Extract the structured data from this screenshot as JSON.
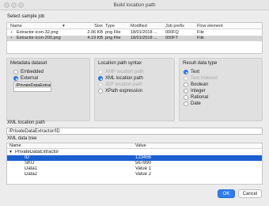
{
  "window": {
    "title": "Build location path"
  },
  "sample_job": {
    "label": "Select sample job",
    "columns": [
      "Name",
      "Size",
      "Type",
      "Modified",
      "Job prefix",
      "Flow element"
    ],
    "rows": [
      {
        "name": "Extractor-icon-32.png",
        "size": "2.06 KB",
        "type": "png File",
        "modified": "18/01/2018 ...",
        "prefix": "000FQ",
        "flow": "File"
      },
      {
        "name": "Extractor-icon-200.png",
        "size": "4.19 KB",
        "type": "png File",
        "modified": "18/01/2018 ...",
        "prefix": "000FT",
        "flow": "File"
      }
    ]
  },
  "metadata_dataset": {
    "label": "Metadata dataset",
    "options": [
      "Embedded",
      "External"
    ],
    "selected": "External",
    "list_item": "/PrivateDataExtractor"
  },
  "location_syntax": {
    "label": "Location path syntax",
    "options": [
      "XMP location path",
      "XML location path",
      "JDF location path",
      "XPath expression"
    ],
    "selected": "XML location path"
  },
  "result_type": {
    "label": "Result data type",
    "options": [
      "Text",
      "Text Indexed",
      "Boolean",
      "Integer",
      "Rational",
      "Date"
    ],
    "selected": "Text"
  },
  "xml_location": {
    "label": "XML location path",
    "value": "/PrivateDataExtractor/ID"
  },
  "xml_tree": {
    "label": "XML data tree",
    "columns": [
      "Name",
      "Value"
    ],
    "root": "PrivateDataExtractor",
    "rows": [
      {
        "name": "ID",
        "value": "123456"
      },
      {
        "name": "SKU",
        "value": "567890"
      },
      {
        "name": "Data1",
        "value": "Value 1"
      },
      {
        "name": "Data2",
        "value": "Value 2"
      }
    ]
  },
  "buttons": {
    "ok": "OK",
    "cancel": "Cancel"
  },
  "colors": {
    "accent": "#2e7cf6",
    "selection": "#1b5fd0"
  }
}
